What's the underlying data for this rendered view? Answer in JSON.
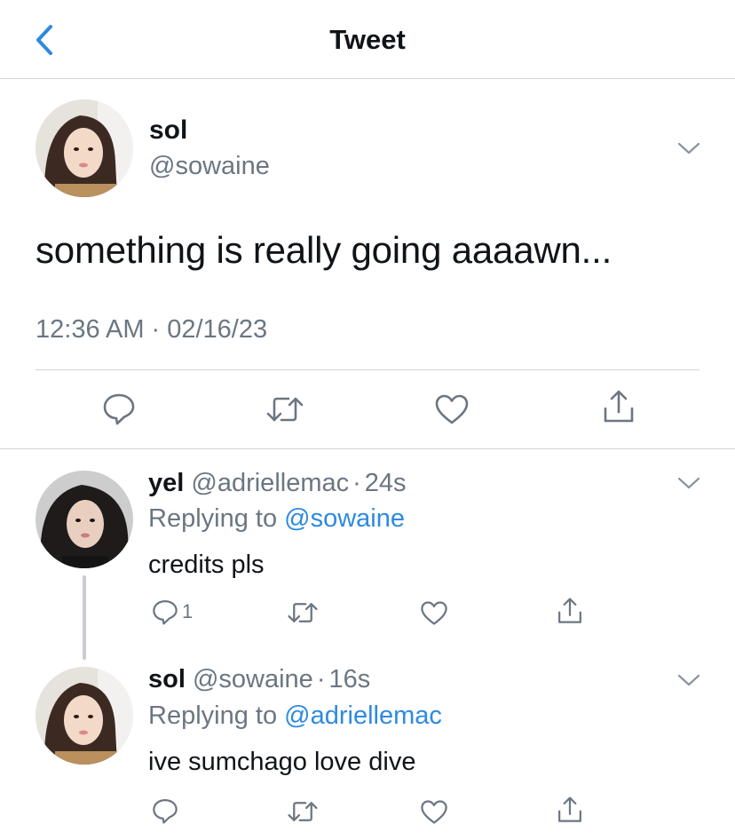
{
  "header": {
    "title": "Tweet"
  },
  "main_tweet": {
    "display_name": "sol",
    "handle": "@sowaine",
    "text": "something is really going aaaawn...",
    "time": "12:36 AM",
    "date": "02/16/23"
  },
  "replies": [
    {
      "display_name": "yel",
      "handle": "@adriellemac",
      "age": "24s",
      "replying_label": "Replying to",
      "replying_to": "@sowaine",
      "text": "credits pls",
      "reply_count": "1"
    },
    {
      "display_name": "sol",
      "handle": "@sowaine",
      "age": "16s",
      "replying_label": "Replying to",
      "replying_to": "@adriellemac",
      "text": "ive sumchago love dive",
      "reply_count": ""
    }
  ],
  "colors": {
    "accent": "#2d8ae0",
    "secondary_text": "#6b7682",
    "divider": "#d0d4d8"
  },
  "icons": [
    "chevron-left-icon",
    "chevron-down-icon",
    "reply-icon",
    "retweet-icon",
    "like-icon",
    "share-icon"
  ]
}
